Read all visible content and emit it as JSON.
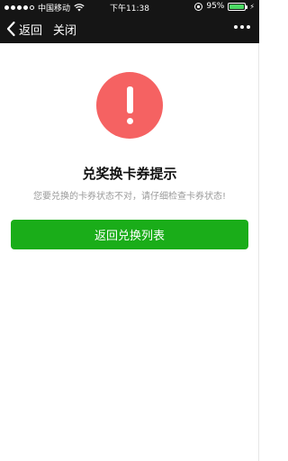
{
  "status_bar": {
    "carrier": "中国移动",
    "time": "下午11:38",
    "battery": "95%",
    "battery_level": 0.95,
    "battery_color": "#4cd964"
  },
  "nav": {
    "back_label": "返回",
    "close_label": "关闭",
    "back_icon": "chevron-left-icon",
    "more_icon": "more-dots-icon"
  },
  "main": {
    "warning_icon": "exclamation-icon",
    "warning_color": "#f56262",
    "title": "兑奖换卡券提示",
    "description": "您要兑换的卡券状态不对，请仔细检查卡券状态!",
    "button_label": "返回兑换列表",
    "button_color": "#1aad19"
  }
}
